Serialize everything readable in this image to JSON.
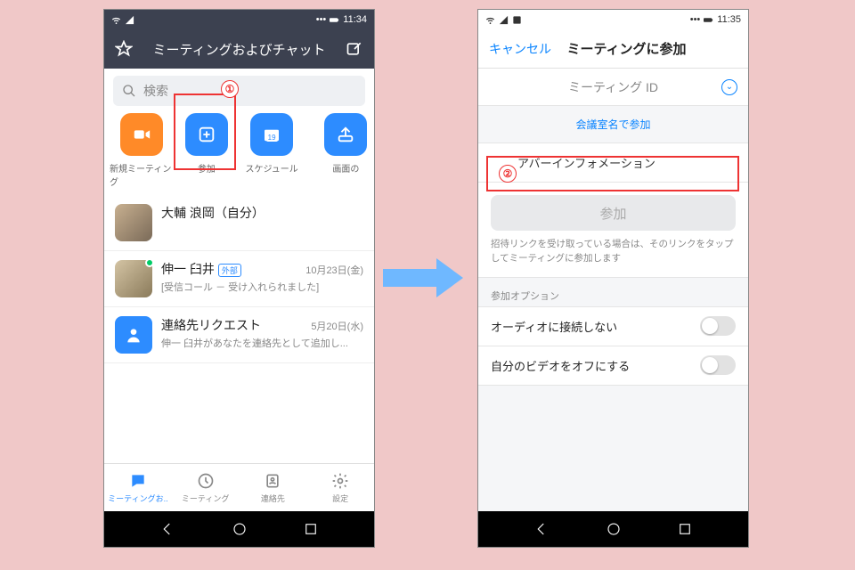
{
  "left": {
    "status_time": "11:34",
    "header_title": "ミーティングおよびチャット",
    "search_placeholder": "検索",
    "annotation1": "①",
    "actions": [
      {
        "label": "新規ミーティング",
        "icon": "video-icon",
        "color": "orange"
      },
      {
        "label": "参加",
        "icon": "plus-icon",
        "color": "blue"
      },
      {
        "label": "スケジュール",
        "icon": "calendar-icon",
        "color": "blue",
        "cal_day": "19"
      },
      {
        "label": "画面の",
        "icon": "share-icon",
        "color": "blue"
      }
    ],
    "contacts": [
      {
        "name": "大輔 浪岡（自分）",
        "sub": "",
        "date": "",
        "avatar": "cat"
      },
      {
        "name": "伸一 臼井",
        "badge": "外部",
        "sub": "[受信コール － 受け入れられました]",
        "date": "10月23日(金)",
        "avatar": "dog",
        "presence": true
      },
      {
        "name": "連絡先リクエスト",
        "sub": "伸一 臼井があなたを連絡先として追加し...",
        "date": "5月20日(水)",
        "avatar": "request"
      }
    ],
    "tabs": [
      {
        "label": "ミーティングお..",
        "icon": "chat-icon",
        "active": true
      },
      {
        "label": "ミーティング",
        "icon": "clock-icon",
        "active": false
      },
      {
        "label": "連絡先",
        "icon": "contacts-icon",
        "active": false
      },
      {
        "label": "設定",
        "icon": "gear-icon",
        "active": false
      }
    ]
  },
  "right": {
    "status_time": "11:35",
    "cancel": "キャンセル",
    "title": "ミーティングに参加",
    "meeting_id_label": "ミーティング ID",
    "room_link": "会議室名で参加",
    "annotation2": "②",
    "name_value": "アバーインフォメーション",
    "join_label": "参加",
    "hint": "招待リンクを受け取っている場合は、そのリンクをタップしてミーティングに参加します",
    "options_header": "参加オプション",
    "options": [
      {
        "label": "オーディオに接続しない",
        "on": false
      },
      {
        "label": "自分のビデオをオフにする",
        "on": false
      }
    ]
  }
}
